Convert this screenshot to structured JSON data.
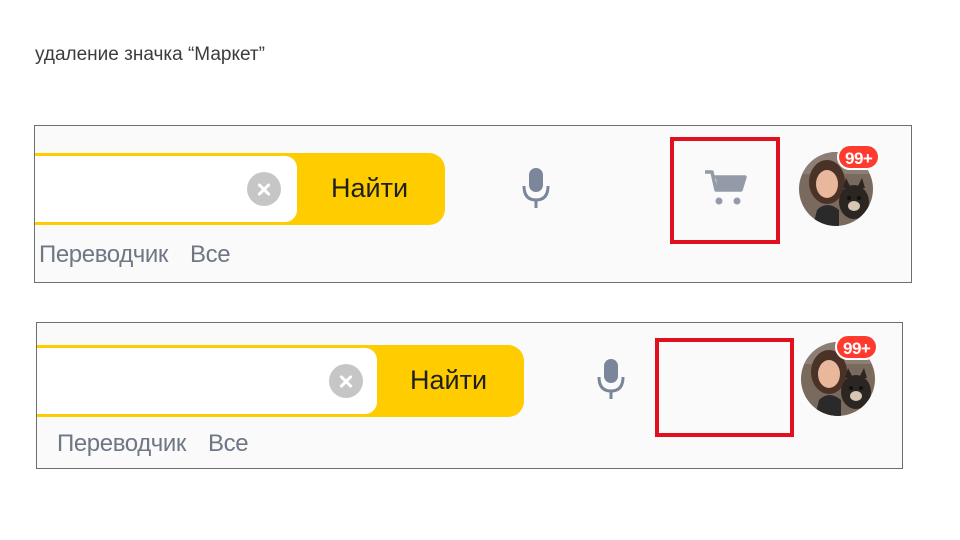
{
  "caption": "удаление значка “Маркет”",
  "search": {
    "button_label": "Найти"
  },
  "links": [
    "Переводчик",
    "Все"
  ],
  "notifications": {
    "count": "99+"
  },
  "colors": {
    "search_accent": "#ffcc00",
    "highlight": "#e0101e",
    "badge": "#ff3b30",
    "link_text": "#6f7785"
  },
  "icons": [
    "clear-icon",
    "microphone-icon",
    "cart-icon",
    "avatar"
  ]
}
